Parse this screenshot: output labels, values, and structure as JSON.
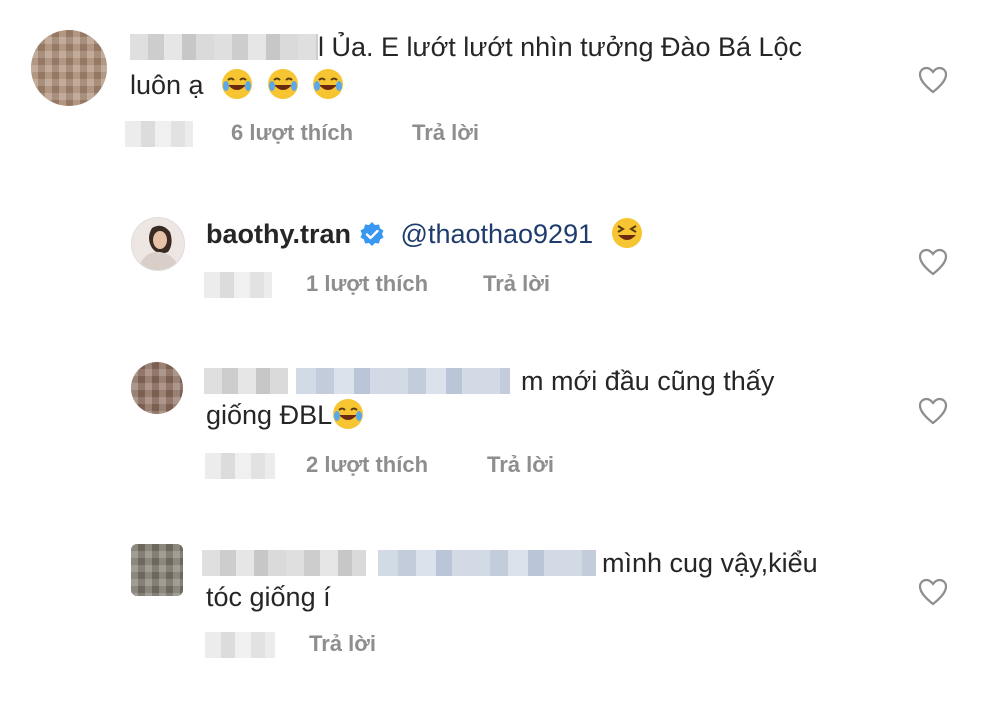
{
  "comments": [
    {
      "line1": "l Ủa. E lướt lướt nhìn tưởng Đào Bá Lộc",
      "line2": "luôn ạ",
      "emojis": [
        "joy-emoji",
        "joy-emoji",
        "joy-emoji"
      ],
      "likes": "6 lượt thích",
      "reply": "Trả lời"
    },
    {
      "username": "baothy.tran",
      "mention": "@thaothao9291",
      "emojis": [
        "laughing-emoji"
      ],
      "likes": "1 lượt thích",
      "reply": "Trả lời"
    },
    {
      "line1": "m mới đầu cũng thấy",
      "line2": "giống ĐBL",
      "emojis": [
        "joy-emoji"
      ],
      "likes": "2 lượt thích",
      "reply": "Trả lời"
    },
    {
      "line1": "mình cug vậy,kiểu",
      "line2": "tóc giống í",
      "reply": "Trả lời"
    }
  ],
  "colors": {
    "text": "#262626",
    "meta": "#8e8e8e",
    "verified": "#3897f0",
    "heart": "#8e8e8e"
  }
}
